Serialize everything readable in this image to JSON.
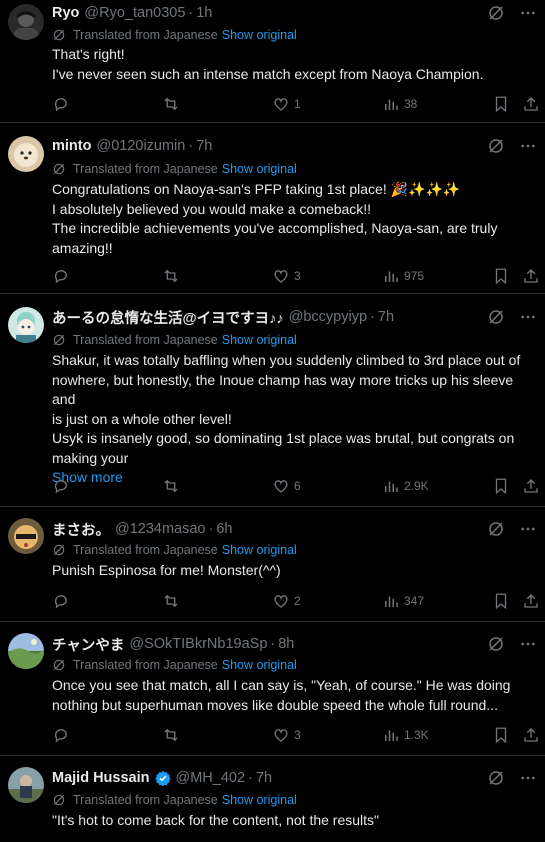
{
  "translation": {
    "label": "Translated from Japanese",
    "link": "Show original"
  },
  "posts": [
    {
      "name": "Ryo",
      "handle": "@Ryo_tan0305",
      "time": "1h",
      "lines": [
        "That's right!",
        "I've never seen such an intense match except from Naoya Champion."
      ],
      "show_more": "",
      "replies": "",
      "likes": "1",
      "views": "38"
    },
    {
      "name": "minto",
      "handle": "@0120izumin",
      "time": "7h",
      "lines": [
        "Congratulations on Naoya-san's PFP taking 1st place! 🎉✨✨✨",
        "I absolutely believed you would make a comeback!!",
        "The incredible achievements you've accomplished, Naoya-san, are truly",
        "amazing!!"
      ],
      "show_more": "",
      "replies": "",
      "likes": "3",
      "views": "975"
    },
    {
      "name": "あーるの怠惰な生活@イヨですヨ♪♪",
      "handle": "@bccypyiyp",
      "time": "7h",
      "lines": [
        "Shakur, it was totally baffling when you suddenly climbed to 3rd place out of",
        "nowhere, but honestly, the Inoue champ has way more tricks up his sleeve and",
        "is just on a whole other level!",
        "Usyk is insanely good, so dominating 1st place was brutal, but congrats on",
        "making your"
      ],
      "show_more": "Show more",
      "replies": "",
      "likes": "6",
      "views": "2.9K"
    },
    {
      "name": "まさお。",
      "handle": "@1234masao",
      "time": "6h",
      "lines": [
        "Punish Espinosa for me! Monster(^^)"
      ],
      "show_more": "",
      "replies": "",
      "likes": "2",
      "views": "347"
    },
    {
      "name": "チャンやま",
      "handle": "@SOkTIBkrNb19aSp",
      "time": "8h",
      "lines": [
        "Once you see that match, all I can say is, \"Yeah, of course.\" He was doing",
        "nothing but superhuman moves like double speed the whole full round..."
      ],
      "show_more": "",
      "replies": "",
      "likes": "3",
      "views": "1.3K"
    },
    {
      "name": "Majid Hussain",
      "handle": "@MH_402",
      "time": "7h",
      "verified": true,
      "lines": [
        "\"It's hot to come back for the content, not the results\""
      ],
      "show_more": "",
      "replies": "",
      "likes": "",
      "views": ""
    }
  ],
  "colors": {
    "background": "#000000",
    "text": "#e7e9ea",
    "muted": "#71767b",
    "link": "#1d9bf0",
    "divider": "#2f3336"
  }
}
